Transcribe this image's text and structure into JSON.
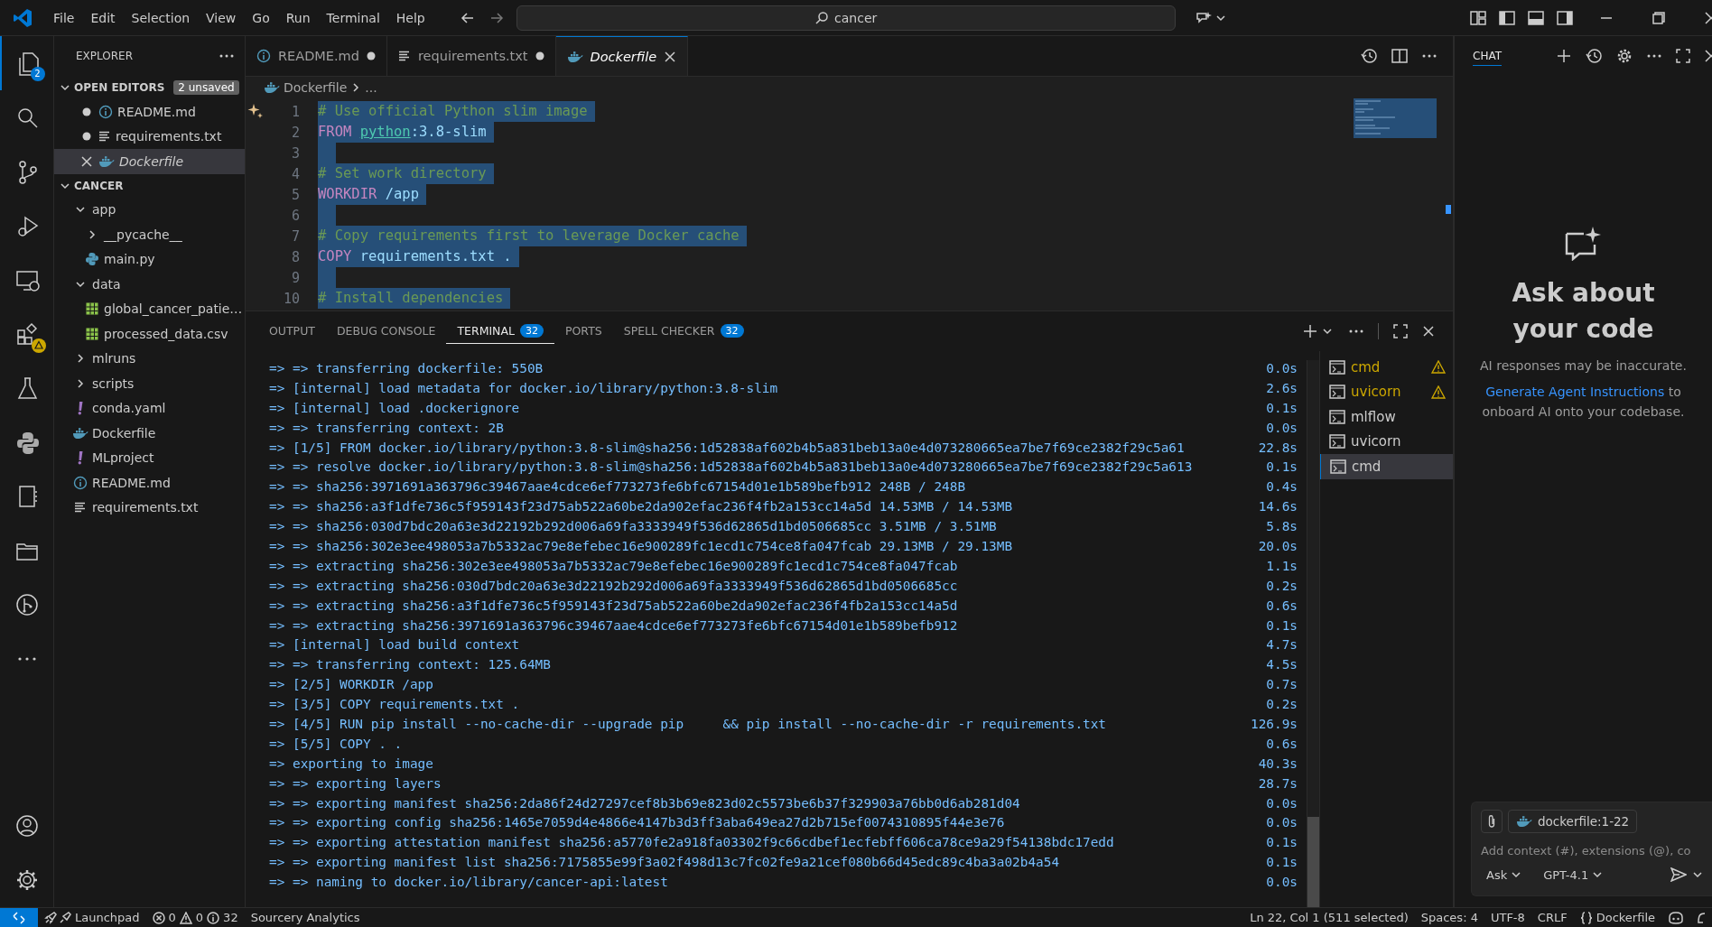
{
  "title_bar": {
    "menu": [
      "File",
      "Edit",
      "Selection",
      "View",
      "Go",
      "Run",
      "Terminal",
      "Help"
    ],
    "search": "cancer"
  },
  "activity_bar": {
    "explorer_badge": "2"
  },
  "explorer": {
    "title": "EXPLORER",
    "open_editors": {
      "title": "OPEN EDITORS",
      "badge": "2 unsaved",
      "items": [
        {
          "name": "README.md",
          "kind": "info",
          "unsaved": true,
          "selected": false
        },
        {
          "name": "requirements.txt",
          "kind": "text",
          "unsaved": true,
          "selected": false
        },
        {
          "name": "Dockerfile",
          "kind": "docker",
          "unsaved": false,
          "selected": true
        }
      ]
    },
    "folder": {
      "title": "CANCER",
      "expanded": true,
      "children": [
        {
          "name": "app",
          "kind": "folder",
          "expanded": true,
          "children": [
            {
              "name": "__pycache__",
              "kind": "folder",
              "expanded": false
            },
            {
              "name": "main.py",
              "kind": "python"
            }
          ]
        },
        {
          "name": "data",
          "kind": "folder",
          "expanded": true,
          "children": [
            {
              "name": "global_cancer_patie…",
              "kind": "csv"
            },
            {
              "name": "processed_data.csv",
              "kind": "csv"
            }
          ]
        },
        {
          "name": "mlruns",
          "kind": "folder",
          "expanded": false
        },
        {
          "name": "scripts",
          "kind": "folder",
          "expanded": false
        },
        {
          "name": "conda.yaml",
          "kind": "yaml"
        },
        {
          "name": "Dockerfile",
          "kind": "docker"
        },
        {
          "name": "MLproject",
          "kind": "yaml"
        },
        {
          "name": "README.md",
          "kind": "info"
        },
        {
          "name": "requirements.txt",
          "kind": "text"
        }
      ]
    }
  },
  "tabs": [
    {
      "label": "README.md",
      "kind": "info",
      "unsaved": true,
      "selected": false
    },
    {
      "label": "requirements.txt",
      "kind": "text",
      "unsaved": true,
      "selected": false
    },
    {
      "label": "Dockerfile",
      "kind": "docker",
      "unsaved": false,
      "selected": true
    }
  ],
  "breadcrumb": [
    "Dockerfile",
    "..."
  ],
  "code_lines": [
    {
      "number": "1",
      "selected": true,
      "tokens": [
        {
          "kind": "comment",
          "text": "# Use official Python slim image"
        }
      ]
    },
    {
      "number": "2",
      "selected": true,
      "tokens": [
        {
          "kind": "keyword",
          "text": "FROM "
        },
        {
          "kind": "image",
          "text": "python"
        },
        {
          "kind": "value",
          "text": ":3.8-slim"
        }
      ]
    },
    {
      "number": "3",
      "selected": true
    },
    {
      "number": "4",
      "selected": true,
      "tokens": [
        {
          "kind": "comment",
          "text": "# Set work directory"
        }
      ]
    },
    {
      "number": "5",
      "selected": true,
      "tokens": [
        {
          "kind": "keyword",
          "text": "WORKDIR"
        },
        {
          "kind": "value",
          "text": " /app"
        }
      ]
    },
    {
      "number": "6",
      "selected": true
    },
    {
      "number": "7",
      "selected": true,
      "tokens": [
        {
          "kind": "comment",
          "text": "# Copy requirements first to leverage Docker cache"
        }
      ]
    },
    {
      "number": "8",
      "selected": true,
      "tokens": [
        {
          "kind": "keyword",
          "text": "COPY"
        },
        {
          "kind": "value",
          "text": " requirements.txt ."
        }
      ]
    },
    {
      "number": "9",
      "selected": true
    },
    {
      "number": "10",
      "selected": true,
      "tokens": [
        {
          "kind": "comment",
          "text": "# Install dependencies"
        }
      ]
    }
  ],
  "panel_tabs": [
    {
      "label": "OUTPUT",
      "selected": false
    },
    {
      "label": "DEBUG CONSOLE",
      "selected": false
    },
    {
      "label": "TERMINAL",
      "badge": "32",
      "selected": true
    },
    {
      "label": "PORTS",
      "selected": false
    },
    {
      "label": "SPELL CHECKER",
      "badge": "32",
      "selected": false
    }
  ],
  "terminal_lines": [
    {
      "text": "=> => transferring dockerfile: 550B",
      "time": "0.0s"
    },
    {
      "text": "=> [internal] load metadata for docker.io/library/python:3.8-slim",
      "time": "2.6s"
    },
    {
      "text": "=> [internal] load .dockerignore",
      "time": "0.1s"
    },
    {
      "text": "=> => transferring context: 2B",
      "time": "0.0s"
    },
    {
      "text": "=> [1/5] FROM docker.io/library/python:3.8-slim@sha256:1d52838af602b4b5a831beb13a0e4d073280665ea7be7f69ce2382f29c5a61",
      "time": "22.8s"
    },
    {
      "text": "=> => resolve docker.io/library/python:3.8-slim@sha256:1d52838af602b4b5a831beb13a0e4d073280665ea7be7f69ce2382f29c5a613",
      "time": "0.1s"
    },
    {
      "text": "=> => sha256:3971691a363796c39467aae4cdce6ef773273fe6bfc67154d01e1b589befb912 248B / 248B",
      "time": "0.4s"
    },
    {
      "text": "=> => sha256:a3f1dfe736c5f959143f23d75ab522a60be2da902efac236f4fb2a153cc14a5d 14.53MB / 14.53MB",
      "time": "14.6s"
    },
    {
      "text": "=> => sha256:030d7bdc20a63e3d22192b292d006a69fa3333949f536d62865d1bd0506685cc 3.51MB / 3.51MB",
      "time": "5.8s"
    },
    {
      "text": "=> => sha256:302e3ee498053a7b5332ac79e8efebec16e900289fc1ecd1c754ce8fa047fcab 29.13MB / 29.13MB",
      "time": "20.0s"
    },
    {
      "text": "=> => extracting sha256:302e3ee498053a7b5332ac79e8efebec16e900289fc1ecd1c754ce8fa047fcab",
      "time": "1.1s"
    },
    {
      "text": "=> => extracting sha256:030d7bdc20a63e3d22192b292d006a69fa3333949f536d62865d1bd0506685cc",
      "time": "0.2s"
    },
    {
      "text": "=> => extracting sha256:a3f1dfe736c5f959143f23d75ab522a60be2da902efac236f4fb2a153cc14a5d",
      "time": "0.6s"
    },
    {
      "text": "=> => extracting sha256:3971691a363796c39467aae4cdce6ef773273fe6bfc67154d01e1b589befb912",
      "time": "0.1s"
    },
    {
      "text": "=> [internal] load build context",
      "time": "4.7s"
    },
    {
      "text": "=> => transferring context: 125.64MB",
      "time": "4.5s"
    },
    {
      "text": "=> [2/5] WORKDIR /app",
      "time": "0.7s"
    },
    {
      "text": "=> [3/5] COPY requirements.txt .",
      "time": "0.2s"
    },
    {
      "text": "=> [4/5] RUN pip install --no-cache-dir --upgrade pip     && pip install --no-cache-dir -r requirements.txt",
      "time": "126.9s"
    },
    {
      "text": "=> [5/5] COPY . .",
      "time": "0.6s"
    },
    {
      "text": "=> exporting to image",
      "time": "40.3s"
    },
    {
      "text": "=> => exporting layers",
      "time": "28.7s"
    },
    {
      "text": "=> => exporting manifest sha256:2da86f24d27297cef8b3b69e823d02c5573be6b37f329903a76bb0d6ab281d04",
      "time": "0.0s"
    },
    {
      "text": "=> => exporting config sha256:1465e7059d4e4866e4147b3d3ff3aba649ea27d2b715ef0074310895f44e3e76",
      "time": "0.0s"
    },
    {
      "text": "=> => exporting attestation manifest sha256:a5770fe2a918fa03302f9c66cdbef1ecfebff606ca78ce9a29f54138bdc17edd",
      "time": "0.1s"
    },
    {
      "text": "=> => exporting manifest list sha256:7175855e99f3a02f498d13c7fc02fe9a21cef080b66d45edc89c4ba3a02b4a54",
      "time": "0.1s"
    },
    {
      "text": "=> => naming to docker.io/library/cancer-api:latest",
      "time": "0.0s"
    }
  ],
  "terminals": [
    {
      "name": "cmd",
      "warning": true,
      "selected": false
    },
    {
      "name": "uvicorn",
      "warning": true,
      "selected": false
    },
    {
      "name": "mlflow",
      "warning": false,
      "selected": false
    },
    {
      "name": "uvicorn",
      "warning": false,
      "selected": false
    },
    {
      "name": "cmd",
      "warning": false,
      "selected": true
    }
  ],
  "chat": {
    "title": "CHAT",
    "heading": "Ask about your code",
    "note": "AI responses may be inaccurate.",
    "link": "Generate Agent Instructions",
    "link_rest": " to onboard AI onto your codebase.",
    "context_chip": "dockerfile:1-22",
    "placeholder": "Add context (#), extensions (@), co",
    "mode": "Ask",
    "model": "GPT-4.1"
  },
  "status_bar": {
    "launchpad": "Launchpad",
    "errors": "0",
    "warnings": "0",
    "infos": "32",
    "sourcery": "Sourcery Analytics",
    "position": "Ln 22, Col 1 (511 selected)",
    "spaces": "Spaces: 4",
    "encoding": "UTF-8",
    "eol": "CRLF",
    "language": "Dockerfile"
  }
}
